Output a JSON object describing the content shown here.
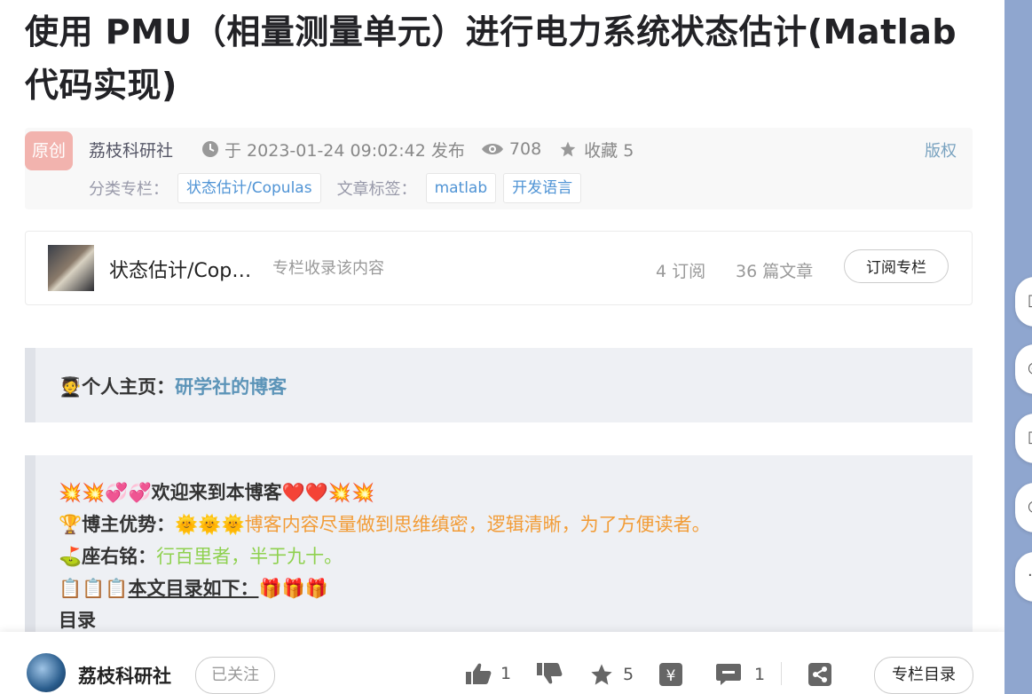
{
  "article": {
    "title": "使用 PMU（相量测量单元）进行电力系统状态估计(Matlab代码实现)",
    "badge": "原创",
    "author": "荔枝科研社",
    "publish_time": "于 2023-01-24 09:02:42 发布",
    "views": "708",
    "favorites": "收藏 5",
    "copyright": "版权",
    "category_label": "分类专栏：",
    "category_tag": "状态估计/Copulas",
    "tags_label": "文章标签：",
    "tags": [
      "matlab",
      "开发语言"
    ]
  },
  "column_card": {
    "name": "状态估计/Cop…",
    "desc": "专栏收录该内容",
    "subs": "4 订阅",
    "count": "36 篇文章",
    "button": "订阅专栏"
  },
  "content": {
    "homepage_emoji": "🧑‍🎓",
    "homepage_label": "个人主页：",
    "homepage_link": "研学社的博客",
    "welcome_prefix": "💥💥💞💞",
    "welcome_text": "欢迎来到本博客",
    "welcome_suffix": "❤️❤️💥💥",
    "advantage_emoji": "🏆",
    "advantage_label": "博主优势：",
    "advantage_suns": "🌞🌞🌞",
    "advantage_text": "博客内容尽量做到思维缜密，逻辑清晰，为了方便读者。",
    "motto_emoji": "⛳️",
    "motto_label": "座右铭：",
    "motto_text": "行百里者，半于九十。",
    "toc_prefix": "📋📋📋",
    "toc_text": "本文目录如下：",
    "toc_suffix": "🎁🎁🎁",
    "toc_heading": "目录"
  },
  "bottom_bar": {
    "author": "荔枝科研社",
    "follow": "已关注",
    "likes": "1",
    "favorites": "5",
    "comments": "1",
    "column_btn": "专栏目录"
  },
  "icons": [
    "clock-icon",
    "eye-icon",
    "star-icon",
    "thumbs-up-icon",
    "thumbs-down-icon",
    "favorite-icon",
    "reward-icon",
    "comment-icon",
    "share-icon"
  ],
  "colors": {
    "badge": "#f2b3ae",
    "link": "#5094d5",
    "accent_orange": "#f29c37",
    "accent_green": "#8fd14f",
    "rail": "#8fa6cf"
  }
}
